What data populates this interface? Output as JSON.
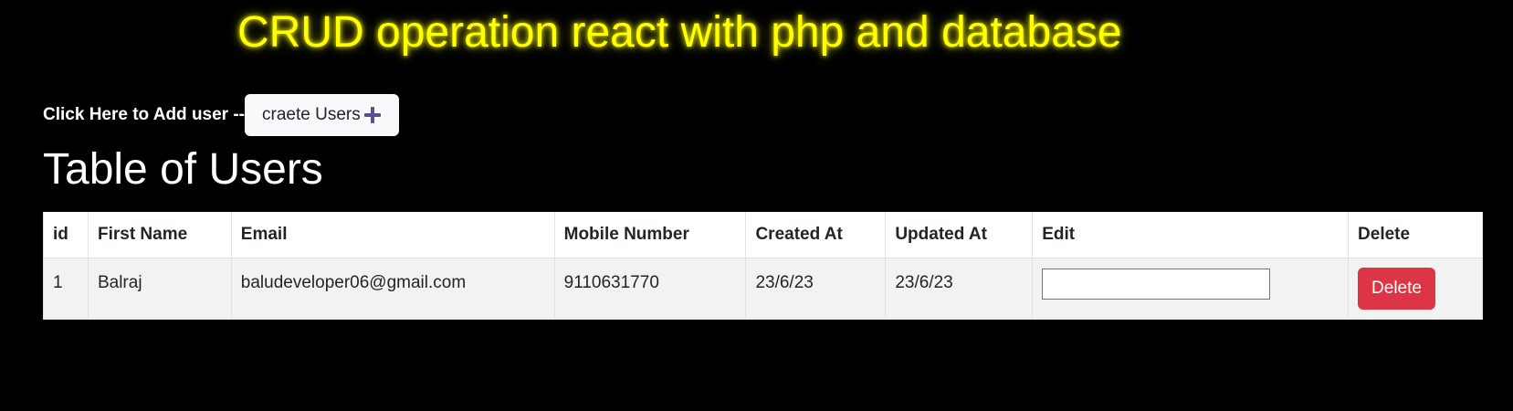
{
  "banner": {
    "title": "CRUD operation react with php and database"
  },
  "add_user": {
    "label": "Click Here to Add user --",
    "button_label": "craete Users",
    "button_icon": "plus-icon"
  },
  "table": {
    "title": "Table of Users",
    "columns": [
      "id",
      "First Name",
      "Email",
      "Mobile Number",
      "Created At",
      "Updated At",
      "Edit",
      "Delete"
    ],
    "rows": [
      {
        "id": "1",
        "first_name": "Balraj",
        "email": "baludeveloper06@gmail.com",
        "mobile": "9110631770",
        "created_at": "23/6/23",
        "updated_at": "23/6/23",
        "edit_value": "",
        "delete_label": "Delete"
      }
    ]
  },
  "colors": {
    "background": "#000000",
    "banner": "#ffff00",
    "delete": "#dc3545",
    "plus_icon": "#5c4d8c"
  }
}
